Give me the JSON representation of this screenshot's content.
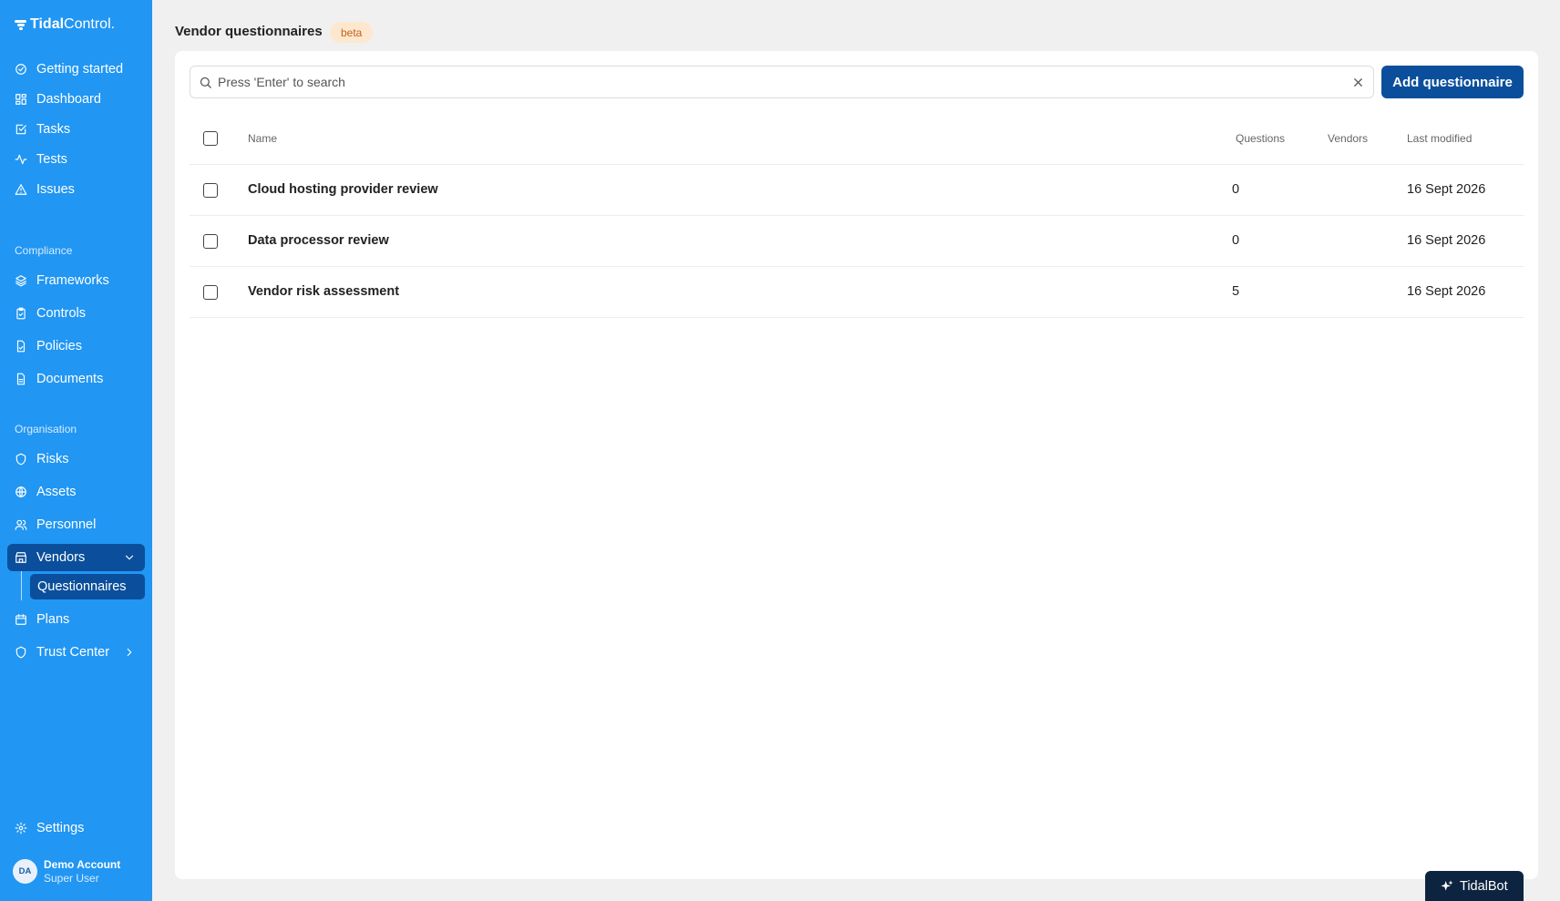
{
  "brand": {
    "name_bold": "Tidal",
    "name_light": "Control."
  },
  "sidebar": {
    "items_top": [
      {
        "label": "Getting started",
        "icon": "check-circle-icon"
      },
      {
        "label": "Dashboard",
        "icon": "grid-icon"
      },
      {
        "label": "Tasks",
        "icon": "check-square-icon"
      },
      {
        "label": "Tests",
        "icon": "activity-icon"
      },
      {
        "label": "Issues",
        "icon": "alert-triangle-icon"
      }
    ],
    "section_compliance": "Compliance",
    "items_compliance": [
      {
        "label": "Frameworks",
        "icon": "layers-icon"
      },
      {
        "label": "Controls",
        "icon": "clipboard-check-icon"
      },
      {
        "label": "Policies",
        "icon": "file-check-icon"
      },
      {
        "label": "Documents",
        "icon": "file-text-icon"
      }
    ],
    "section_organisation": "Organisation",
    "items_organisation": [
      {
        "label": "Risks",
        "icon": "shield-alert-icon"
      },
      {
        "label": "Assets",
        "icon": "globe-icon"
      },
      {
        "label": "Personnel",
        "icon": "users-icon"
      },
      {
        "label": "Vendors",
        "icon": "store-icon",
        "active": true
      },
      {
        "label": "Questionnaires",
        "icon": "",
        "sub": true,
        "active": true
      },
      {
        "label": "Plans",
        "icon": "calendar-icon"
      },
      {
        "label": "Trust Center",
        "icon": "shield-icon"
      }
    ],
    "settings": {
      "label": "Settings",
      "icon": "gear-icon"
    },
    "user": {
      "initials": "DA",
      "name": "Demo Account",
      "role": "Super User"
    }
  },
  "header": {
    "title": "Vendor questionnaires",
    "badge": "beta"
  },
  "search": {
    "placeholder": "Press 'Enter' to search",
    "value": ""
  },
  "actions": {
    "add_label": "Add questionnaire"
  },
  "table": {
    "columns": {
      "name": "Name",
      "questions": "Questions",
      "vendors": "Vendors",
      "last_modified": "Last modified"
    },
    "rows": [
      {
        "name": "Cloud hosting provider review",
        "questions": "0",
        "vendors": "",
        "last_modified": "16 Sept 2026"
      },
      {
        "name": "Data processor review",
        "questions": "0",
        "vendors": "",
        "last_modified": "16 Sept 2026"
      },
      {
        "name": "Vendor risk assessment",
        "questions": "5",
        "vendors": "",
        "last_modified": "16 Sept 2026"
      }
    ]
  },
  "tidalbot": {
    "label": "TidalBot",
    "icon": "sparkles-icon"
  },
  "colors": {
    "sidebar": "#2196f3",
    "active": "#0b4f9c",
    "primary_button": "#0b4f9c",
    "badge_bg": "#fde8cf",
    "badge_text": "#c2621a",
    "bot": "#0d2440"
  }
}
